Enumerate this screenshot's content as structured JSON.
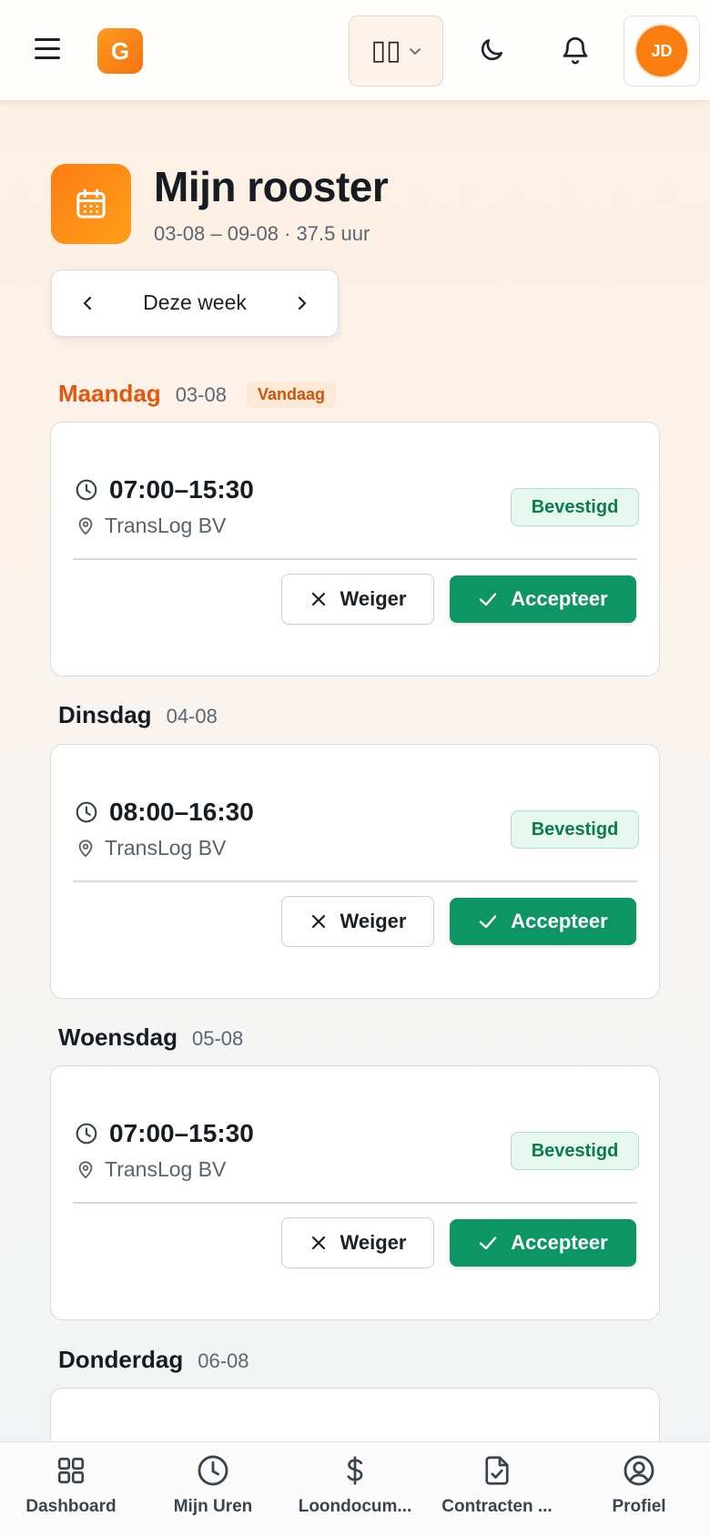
{
  "header": {
    "logo_letter": "G",
    "view_switch_glyph": "▯▯",
    "avatar_initials": "JD",
    "icons": [
      "menu-icon",
      "columns-icon",
      "chevron-down-icon",
      "moon-icon",
      "bell-icon"
    ]
  },
  "page": {
    "title": "Mijn rooster",
    "subtitle": "03-08 – 09-08 · 37.5 uur",
    "week_label": "Deze week",
    "prev_arrow": "‹",
    "next_arrow": "›"
  },
  "days": [
    {
      "name": "Maandag",
      "date": "03-08",
      "today_label": "Vandaag",
      "is_today": true,
      "time": "07:00–15:30",
      "location": "TransLog BV",
      "status": "Bevestigd",
      "reject_label": "Weiger",
      "accept_label": "Accepteer"
    },
    {
      "name": "Dinsdag",
      "date": "04-08",
      "is_today": false,
      "time": "08:00–16:30",
      "location": "TransLog BV",
      "status": "Bevestigd",
      "reject_label": "Weiger",
      "accept_label": "Accepteer"
    },
    {
      "name": "Woensdag",
      "date": "05-08",
      "is_today": false,
      "time": "07:00–15:30",
      "location": "TransLog BV",
      "status": "Bevestigd",
      "reject_label": "Weiger",
      "accept_label": "Accepteer"
    },
    {
      "name": "Donderdag",
      "date": "06-08",
      "is_today": false
    }
  ],
  "bottom_nav": [
    {
      "label": "Dashboard",
      "icon": "dashboard-icon"
    },
    {
      "label": "Mijn Uren",
      "icon": "clock-icon"
    },
    {
      "label": "Loondocum...",
      "icon": "dollar-icon"
    },
    {
      "label": "Contracten ...",
      "icon": "document-check-icon"
    },
    {
      "label": "Profiel",
      "icon": "user-circle-icon"
    }
  ],
  "colors": {
    "accent": "#f97d10",
    "today": "#e8560d",
    "accept": "#0d9563",
    "status_text": "#0d7a50",
    "status_bg": "#e6f7ef"
  }
}
